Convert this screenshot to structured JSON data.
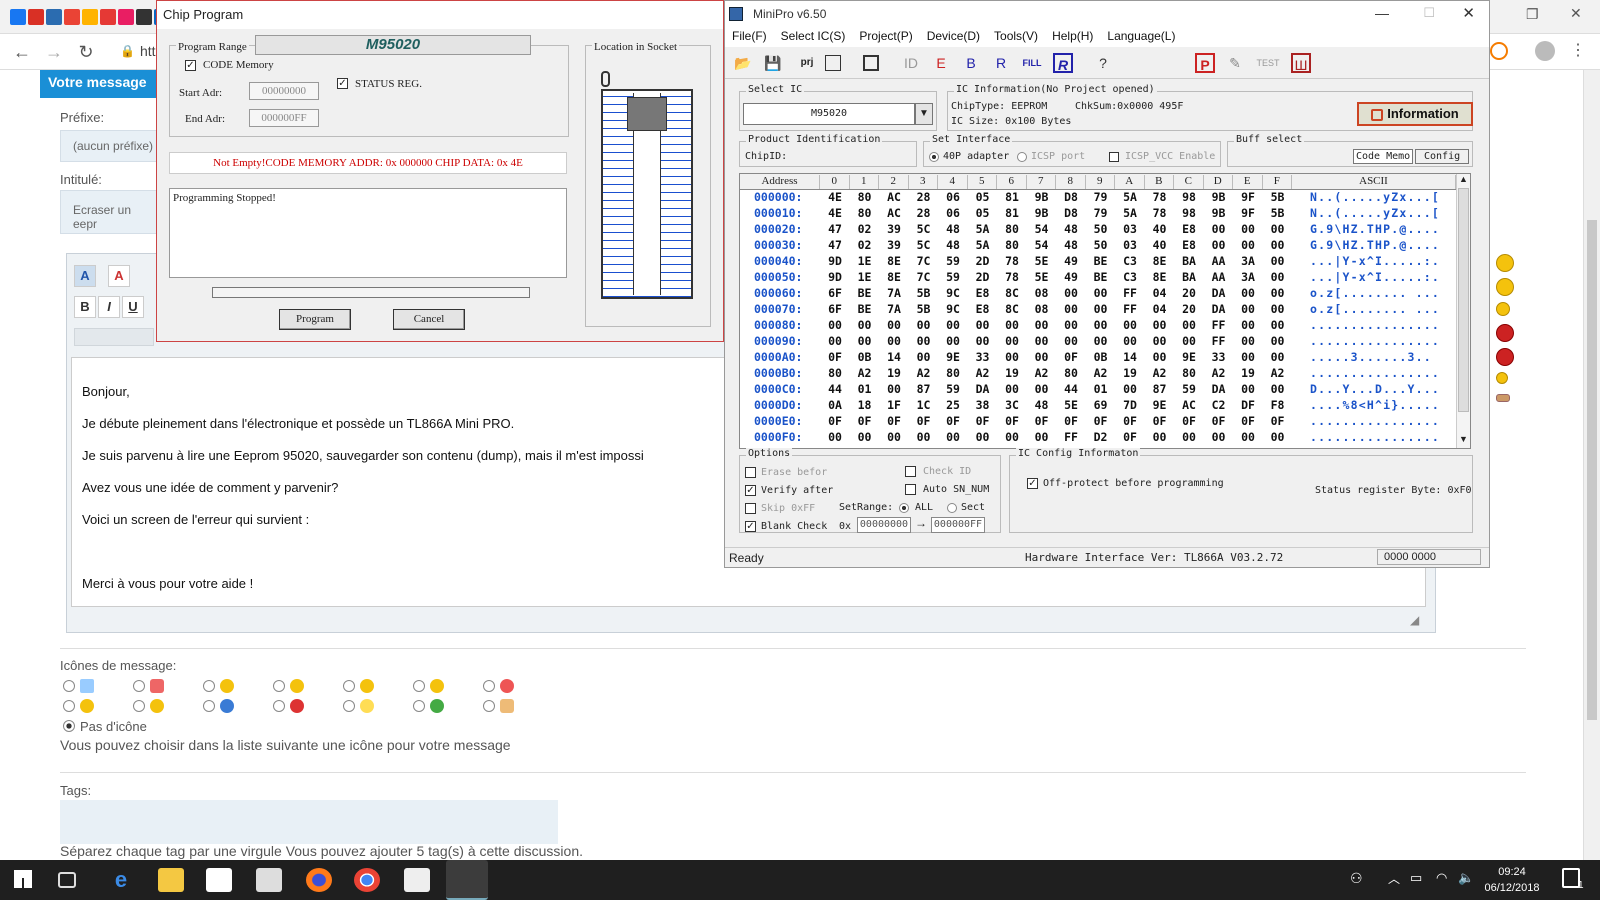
{
  "browser": {
    "url_fragment": "htt",
    "bookmark_colors": [
      "#1877f2",
      "#d93025",
      "#2b6cb0",
      "#ea4335",
      "#ffb300",
      "#e53935",
      "#e91e63",
      "#333333",
      "#0a66c2",
      "#1565c0",
      "#2e7d32"
    ]
  },
  "forum": {
    "header": "Votre message",
    "prefix_label": "Préfixe:",
    "prefix_value": "(aucun préfixe)",
    "title_label": "Intitulé:",
    "title_value": "Ecraser un eepr",
    "message_lines": [
      "Bonjour,",
      "Je débute pleinement dans l'électronique et possède un TL866A Mini PRO.",
      "Je suis parvenu à lire une Eeprom 95020, sauvegarder son contenu (dump), mais il m'est impossi",
      "Avez vous une idée de comment y parvenir?",
      "Voici un screen de l'erreur qui survient :",
      "",
      "Merci à vous pour votre aide !"
    ],
    "icons_label": "Icônes de message:",
    "no_icon_label": "Pas d'icône",
    "icons_hint": "Vous pouvez choisir dans la liste suivante une icône pour votre message",
    "tags_label": "Tags:",
    "tags_hint": "Séparez chaque tag par une virgule Vous pouvez ajouter 5 tag(s) à cette discussion."
  },
  "chip_dialog": {
    "title": "Chip Program",
    "program_range": "Program Range",
    "chip_name": "M95020",
    "code_memory": "CODE Memory",
    "status_reg": "STATUS REG.",
    "start_label": "Start Adr:",
    "start_value": "00000000",
    "end_label": "End Adr:",
    "end_value": "000000FF",
    "location": "Location in Socket",
    "status_msg": "Not Empty!CODE MEMORY ADDR: 0x 000000 CHIP DATA: 0x 4E",
    "log": "Programming Stopped!",
    "program_btn": "Program",
    "cancel_btn": "Cancel"
  },
  "minipro": {
    "title": "MiniPro v6.50",
    "menu": [
      "File(F)",
      "Select IC(S)",
      "Project(P)",
      "Device(D)",
      "Tools(V)",
      "Help(H)",
      "Language(L)"
    ],
    "select_ic_label": "Select IC",
    "select_ic_value": "M95020",
    "ic_info_label": "IC Information(No Project opened)",
    "chip_type": "ChipType:  EEPROM",
    "chksum": "ChkSum:0x0000 495F",
    "ic_size": "IC Size:   0x100 Bytes",
    "info_btn": "Information",
    "product_id_label": "Product Identification",
    "chip_id": "ChipID:",
    "set_interface": "Set Interface",
    "adapter_40p": "40P adapter",
    "icsp_port": "ICSP port",
    "icsp_vcc": "ICSP_VCC Enable",
    "buff_select": "Buff select",
    "code_memo": "Code Memo",
    "config": "Config",
    "hex_header": {
      "address": "Address",
      "cols": [
        "0",
        "1",
        "2",
        "3",
        "4",
        "5",
        "6",
        "7",
        "8",
        "9",
        "A",
        "B",
        "C",
        "D",
        "E",
        "F"
      ],
      "ascii": "ASCII"
    },
    "hex_rows": [
      {
        "addr": "000000:",
        "bytes": [
          "4E",
          "80",
          "AC",
          "28",
          "06",
          "05",
          "81",
          "9B",
          "D8",
          "79",
          "5A",
          "78",
          "98",
          "9B",
          "9F",
          "5B"
        ],
        "ascii": "N..(.....yZx...["
      },
      {
        "addr": "000010:",
        "bytes": [
          "4E",
          "80",
          "AC",
          "28",
          "06",
          "05",
          "81",
          "9B",
          "D8",
          "79",
          "5A",
          "78",
          "98",
          "9B",
          "9F",
          "5B"
        ],
        "ascii": "N..(.....yZx...["
      },
      {
        "addr": "000020:",
        "bytes": [
          "47",
          "02",
          "39",
          "5C",
          "48",
          "5A",
          "80",
          "54",
          "48",
          "50",
          "03",
          "40",
          "E8",
          "00",
          "00",
          "00"
        ],
        "ascii": "G.9\\HZ.THP.@...."
      },
      {
        "addr": "000030:",
        "bytes": [
          "47",
          "02",
          "39",
          "5C",
          "48",
          "5A",
          "80",
          "54",
          "48",
          "50",
          "03",
          "40",
          "E8",
          "00",
          "00",
          "00"
        ],
        "ascii": "G.9\\HZ.THP.@...."
      },
      {
        "addr": "000040:",
        "bytes": [
          "9D",
          "1E",
          "8E",
          "7C",
          "59",
          "2D",
          "78",
          "5E",
          "49",
          "BE",
          "C3",
          "8E",
          "BA",
          "AA",
          "3A",
          "00"
        ],
        "ascii": "...|Y-x^I.....:."
      },
      {
        "addr": "000050:",
        "bytes": [
          "9D",
          "1E",
          "8E",
          "7C",
          "59",
          "2D",
          "78",
          "5E",
          "49",
          "BE",
          "C3",
          "8E",
          "BA",
          "AA",
          "3A",
          "00"
        ],
        "ascii": "...|Y-x^I.....:."
      },
      {
        "addr": "000060:",
        "bytes": [
          "6F",
          "BE",
          "7A",
          "5B",
          "9C",
          "E8",
          "8C",
          "08",
          "00",
          "00",
          "FF",
          "04",
          "20",
          "DA",
          "00",
          "00"
        ],
        "ascii": "o.z[........ ..."
      },
      {
        "addr": "000070:",
        "bytes": [
          "6F",
          "BE",
          "7A",
          "5B",
          "9C",
          "E8",
          "8C",
          "08",
          "00",
          "00",
          "FF",
          "04",
          "20",
          "DA",
          "00",
          "00"
        ],
        "ascii": "o.z[........ ..."
      },
      {
        "addr": "000080:",
        "bytes": [
          "00",
          "00",
          "00",
          "00",
          "00",
          "00",
          "00",
          "00",
          "00",
          "00",
          "00",
          "00",
          "00",
          "FF",
          "00",
          "00"
        ],
        "ascii": "................"
      },
      {
        "addr": "000090:",
        "bytes": [
          "00",
          "00",
          "00",
          "00",
          "00",
          "00",
          "00",
          "00",
          "00",
          "00",
          "00",
          "00",
          "00",
          "FF",
          "00",
          "00"
        ],
        "ascii": "................"
      },
      {
        "addr": "0000A0:",
        "bytes": [
          "0F",
          "0B",
          "14",
          "00",
          "9E",
          "33",
          "00",
          "00",
          "0F",
          "0B",
          "14",
          "00",
          "9E",
          "33",
          "00",
          "00"
        ],
        "ascii": ".....3......3.."
      },
      {
        "addr": "0000B0:",
        "bytes": [
          "80",
          "A2",
          "19",
          "A2",
          "80",
          "A2",
          "19",
          "A2",
          "80",
          "A2",
          "19",
          "A2",
          "80",
          "A2",
          "19",
          "A2"
        ],
        "ascii": "................"
      },
      {
        "addr": "0000C0:",
        "bytes": [
          "44",
          "01",
          "00",
          "87",
          "59",
          "DA",
          "00",
          "00",
          "44",
          "01",
          "00",
          "87",
          "59",
          "DA",
          "00",
          "00"
        ],
        "ascii": "D...Y...D...Y..."
      },
      {
        "addr": "0000D0:",
        "bytes": [
          "0A",
          "18",
          "1F",
          "1C",
          "25",
          "38",
          "3C",
          "48",
          "5E",
          "69",
          "7D",
          "9E",
          "AC",
          "C2",
          "DF",
          "F8"
        ],
        "ascii": "....%8<H^i}....."
      },
      {
        "addr": "0000E0:",
        "bytes": [
          "0F",
          "0F",
          "0F",
          "0F",
          "0F",
          "0F",
          "0F",
          "0F",
          "0F",
          "0F",
          "0F",
          "0F",
          "0F",
          "0F",
          "0F",
          "0F"
        ],
        "ascii": "................"
      },
      {
        "addr": "0000F0:",
        "bytes": [
          "00",
          "00",
          "00",
          "00",
          "00",
          "00",
          "00",
          "00",
          "FF",
          "D2",
          "0F",
          "00",
          "00",
          "00",
          "00",
          "00"
        ],
        "ascii": "................"
      }
    ],
    "options_label": "Options",
    "erase_before": "Erase befor",
    "verify_after": "Verify after",
    "skip_ff": "Skip 0xFF",
    "blank_check": "Blank Check",
    "check_id": "Check ID",
    "auto_sn": "Auto SN_NUM",
    "set_range": "SetRange:",
    "range_all": "ALL",
    "range_sect": "Sect",
    "ox": "0x",
    "range_start": "00000000",
    "range_end": "000000FF",
    "ic_config_label": "IC Config Informaton",
    "off_protect": "Off-protect before programming",
    "status_byte": "Status register Byte: 0xF0",
    "status_ready": "Ready",
    "hw_ver": "Hardware Interface Ver: TL866A V03.2.72",
    "counter": "0000 0000"
  },
  "taskbar": {
    "time": "09:24",
    "date": "06/12/2018",
    "notif": "1"
  }
}
